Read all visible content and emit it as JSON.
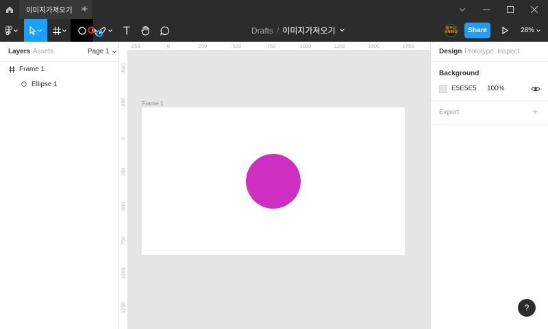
{
  "window": {
    "tab_title": "이미지가져오기",
    "tab_close": "×",
    "tab_add": "+"
  },
  "toolbar": {
    "breadcrumb_drafts": "Drafts",
    "breadcrumb_sep": "/",
    "file_name": "이미지가져오기",
    "avatar_text": "꿈꾸는 ANIMO",
    "share_label": "Share",
    "zoom_label": "28%"
  },
  "left_panel": {
    "tabs": [
      "Layers",
      "Assets"
    ],
    "page_label": "Page 1",
    "layers": [
      {
        "name": "Frame 1",
        "type": "frame"
      },
      {
        "name": "Ellipse 1",
        "type": "ellipse"
      }
    ]
  },
  "rulers": {
    "top": [
      "-250",
      "0",
      "250",
      "500",
      "750",
      "1000",
      "1250",
      "1500",
      "1750"
    ],
    "left": [
      "-500",
      "-250",
      "0",
      "250",
      "500",
      "750",
      "1000",
      "1250"
    ]
  },
  "canvas": {
    "frame_label": "Frame 1",
    "ellipse_color": "#cf2fc1",
    "canvas_bg": "#e5e5e5"
  },
  "right_panel": {
    "tabs": [
      "Design",
      "Prototype",
      "Inspect"
    ],
    "background_title": "Background",
    "background_hex": "E5E5E5",
    "background_opacity": "100%",
    "export_title": "Export"
  },
  "help": {
    "label": "?"
  },
  "colors": {
    "accent": "#18a0fb",
    "chrome": "#2c2c2c",
    "ellipse": "#cf2fc1"
  }
}
